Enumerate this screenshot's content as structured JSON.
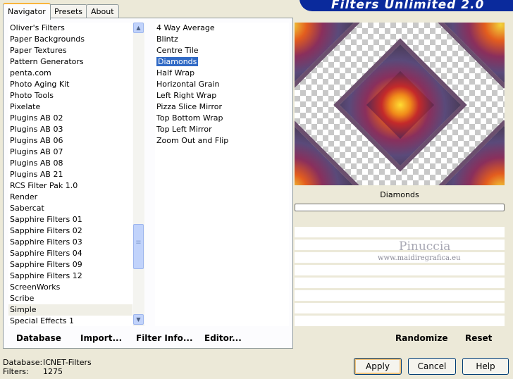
{
  "tabs": [
    {
      "label": "Navigator",
      "active": true
    },
    {
      "label": "Presets",
      "active": false
    },
    {
      "label": "About",
      "active": false
    }
  ],
  "app_title": "Filters Unlimited 2.0",
  "categories": [
    "Oliver's Filters",
    "Paper Backgrounds",
    "Paper Textures",
    "Pattern Generators",
    "penta.com",
    "Photo Aging Kit",
    "Photo Tools",
    "Pixelate",
    "Plugins AB 02",
    "Plugins AB 03",
    "Plugins AB 06",
    "Plugins AB 07",
    "Plugins AB 08",
    "Plugins AB 21",
    "RCS Filter Pak 1.0",
    "Render",
    "Sabercat",
    "Sapphire Filters 01",
    "Sapphire Filters 02",
    "Sapphire Filters 03",
    "Sapphire Filters 04",
    "Sapphire Filters 09",
    "Sapphire Filters 12",
    "ScreenWorks",
    "Scribe",
    "Simple",
    "Special Effects 1"
  ],
  "selected_category": "Simple",
  "filters": [
    "4 Way Average",
    "Blintz",
    "Centre Tile",
    "Diamonds",
    "Half Wrap",
    "Horizontal Grain",
    "Left Right Wrap",
    "Pizza Slice Mirror",
    "Top Bottom Wrap",
    "Top Left Mirror",
    "Zoom Out and Flip"
  ],
  "selected_filter": "Diamonds",
  "preview_label": "Diamonds",
  "watermark": {
    "name": "Pinuccia",
    "url": "www.maidiregrafica.eu"
  },
  "left_buttons": {
    "database": "Database",
    "import": "Import...",
    "filter_info": "Filter Info...",
    "editor": "Editor..."
  },
  "right_buttons": {
    "randomize": "Randomize",
    "reset": "Reset"
  },
  "status": {
    "database_label": "Database:",
    "database_value": "ICNET-Filters",
    "filters_label": "Filters:",
    "filters_value": "1275"
  },
  "dialog_buttons": {
    "apply": "Apply",
    "cancel": "Cancel",
    "help": "Help"
  },
  "icons": {
    "scroll_up": "▲",
    "scroll_down": "▼",
    "grip": "≡"
  }
}
